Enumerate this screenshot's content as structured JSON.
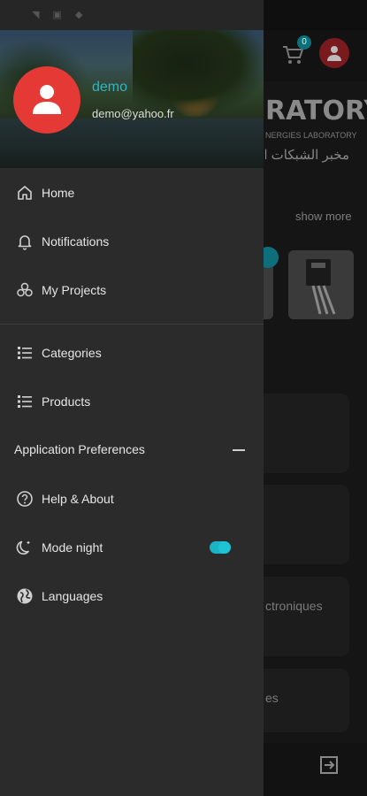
{
  "background": {
    "cart_count": "0",
    "brand_title": "RATORY",
    "brand_subtitle": "NERGIES LABORATORY",
    "brand_arabic": "مخبر الشبكات ال",
    "show_more": "show more",
    "categories": [
      "ctroniques",
      "es"
    ]
  },
  "user": {
    "name": "demo",
    "email": "demo@yahoo.fr"
  },
  "menu": {
    "home": "Home",
    "notifications": "Notifications",
    "my_projects": "My Projects",
    "categories": "Categories",
    "products": "Products",
    "preferences_header": "Application Preferences",
    "help_about": "Help & About",
    "mode_night": "Mode night",
    "mode_night_enabled": true,
    "languages": "Languages"
  },
  "colors": {
    "accent": "#19b5c6",
    "avatar": "#e53935",
    "drawer": "#2b2b2b"
  }
}
